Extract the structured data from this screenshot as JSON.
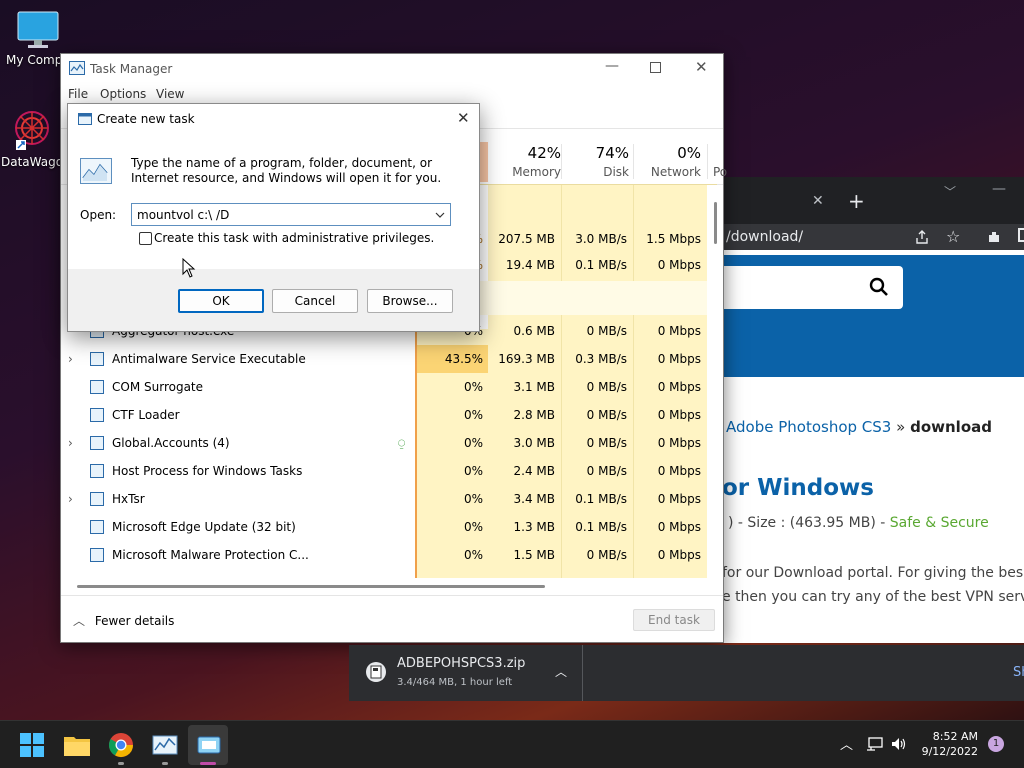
{
  "desktop": {
    "icons": [
      {
        "label": "My Compu"
      },
      {
        "label": "DataWago"
      }
    ]
  },
  "browser": {
    "address": "/download/",
    "breadcrumb_link": "Adobe Photoshop CS3",
    "breadcrumb_sep": "»",
    "breadcrumb_current": "download",
    "heading": "or Windows",
    "size_text": ") - Size : (463.95 MB) -",
    "safe_text": "Safe & Secure",
    "body_line1": "for our Download portal. For giving the bes",
    "body_line2": "e then you can try any of the best VPN serv"
  },
  "taskmgr": {
    "title": "Task Manager",
    "menu": [
      "File",
      "Options",
      "View"
    ],
    "headers": [
      {
        "pct": "42%",
        "label": "Memory"
      },
      {
        "pct": "74%",
        "label": "Disk"
      },
      {
        "pct": "0%",
        "label": "Network"
      },
      {
        "pct": "",
        "label": "Po"
      }
    ],
    "partial_rows": [
      {
        "mem": "207.5 MB",
        "disk": "3.0 MB/s",
        "net": "1.5 Mbps"
      },
      {
        "mem": "19.4 MB",
        "disk": "0.1 MB/s",
        "net": "0 Mbps"
      }
    ],
    "rows": [
      {
        "name": "Aggregator host.exe",
        "cpu": "0%",
        "mem": "0.6 MB",
        "disk": "0 MB/s",
        "net": "0 Mbps",
        "expand": false
      },
      {
        "name": "Antimalware Service Executable",
        "cpu": "43.5%",
        "mem": "169.3 MB",
        "disk": "0.3 MB/s",
        "net": "0 Mbps",
        "expand": true
      },
      {
        "name": "COM Surrogate",
        "cpu": "0%",
        "mem": "3.1 MB",
        "disk": "0 MB/s",
        "net": "0 Mbps",
        "expand": false
      },
      {
        "name": "CTF Loader",
        "cpu": "0%",
        "mem": "2.8 MB",
        "disk": "0 MB/s",
        "net": "0 Mbps",
        "expand": false
      },
      {
        "name": "Global.Accounts (4)",
        "cpu": "0%",
        "mem": "3.0 MB",
        "disk": "0 MB/s",
        "net": "0 Mbps",
        "expand": true
      },
      {
        "name": "Host Process for Windows Tasks",
        "cpu": "0%",
        "mem": "2.4 MB",
        "disk": "0 MB/s",
        "net": "0 Mbps",
        "expand": false
      },
      {
        "name": "HxTsr",
        "cpu": "0%",
        "mem": "3.4 MB",
        "disk": "0.1 MB/s",
        "net": "0 Mbps",
        "expand": true
      },
      {
        "name": "Microsoft Edge Update (32 bit)",
        "cpu": "0%",
        "mem": "1.3 MB",
        "disk": "0.1 MB/s",
        "net": "0 Mbps",
        "expand": false
      },
      {
        "name": "Microsoft Malware Protection C...",
        "cpu": "0%",
        "mem": "1.5 MB",
        "disk": "0 MB/s",
        "net": "0 Mbps",
        "expand": false
      }
    ],
    "fewer_details": "Fewer details",
    "end_task": "End task"
  },
  "dialog": {
    "title": "Create new task",
    "description": "Type the name of a program, folder, document, or Internet resource, and Windows will open it for you.",
    "open_label": "Open:",
    "open_value": "mountvol c:\\ /D",
    "admin_label": "Create this task with administrative privileges.",
    "ok": "OK",
    "cancel": "Cancel",
    "browse": "Browse..."
  },
  "download": {
    "filename": "ADBEPOHSPCS3.zip",
    "progress": "3.4/464 MB, 1 hour left",
    "right_text": "Sh"
  },
  "taskbar": {
    "time": "8:52 AM",
    "date": "9/12/2022",
    "notification_count": "1"
  }
}
